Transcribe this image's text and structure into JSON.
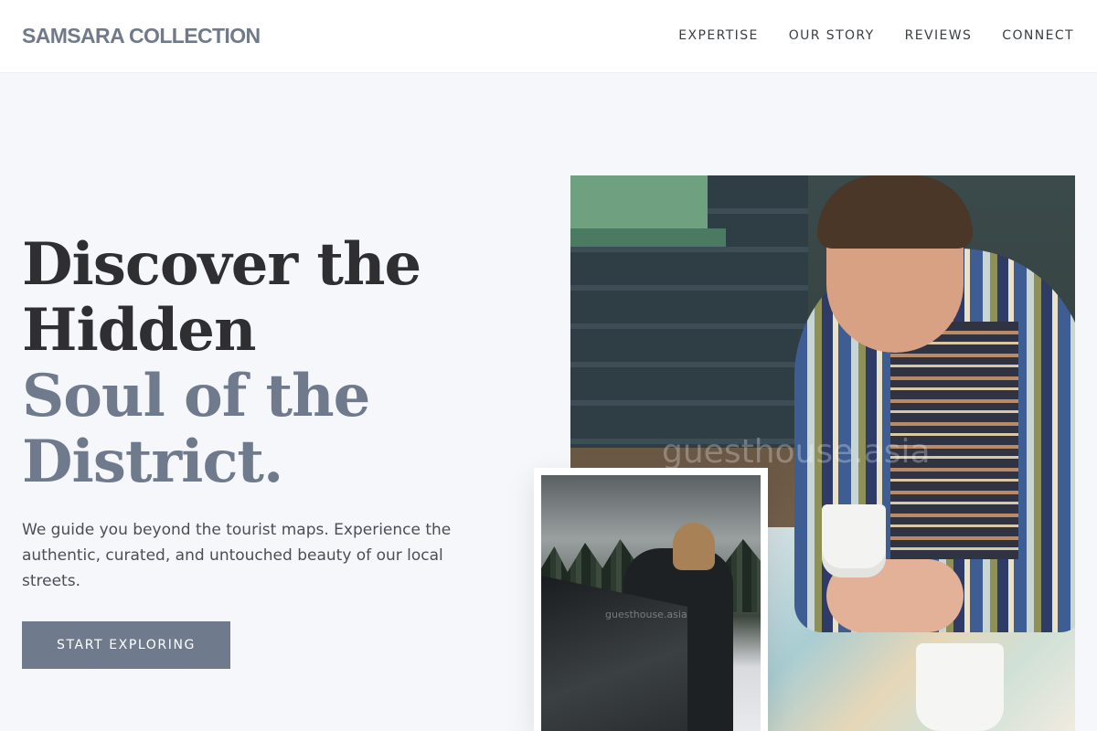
{
  "header": {
    "brand": "SAMSARA COLLECTION",
    "nav": [
      "EXPERTISE",
      "OUR STORY",
      "REVIEWS",
      "CONNECT"
    ]
  },
  "hero": {
    "headline_dark": [
      "Discover the",
      "Hidden"
    ],
    "headline_muted": [
      "Soul of the",
      "District."
    ],
    "lead": "We guide you beyond the tourist maps. Experience the authentic, curated, and untouched beauty of our local streets.",
    "cta": "START EXPLORING"
  },
  "images": {
    "main_watermark": "guesthouse.asia",
    "small_watermark": "guesthouse.asia"
  },
  "colors": {
    "accent": "#6f7b8c",
    "headline_dark": "#2f2f31",
    "background": "#f6f7fb"
  }
}
